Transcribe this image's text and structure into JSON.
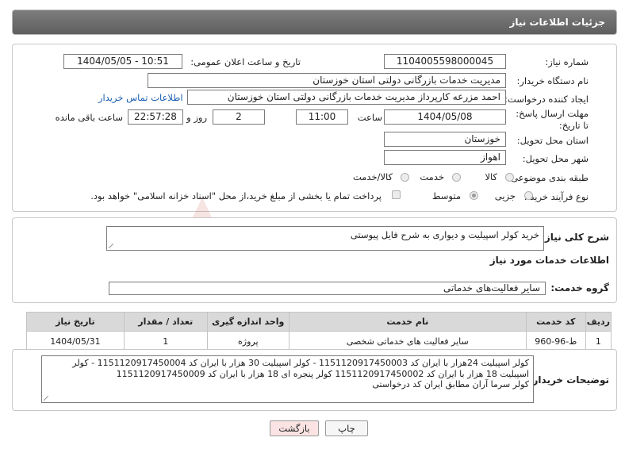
{
  "header": {
    "title": "جزئیات اطلاعات نیاز"
  },
  "form": {
    "need_number_label": "شماره نیاز:",
    "need_number": "1104005598000045",
    "announce_label": "تاریخ و ساعت اعلان عمومی:",
    "announce_value": "1404/05/05 - 10:51",
    "buyer_org_label": "نام دستگاه خریدار:",
    "buyer_org": "مدیریت خدمات بازرگانی دولتی استان خوزستان",
    "creator_label": "ایجاد کننده درخواست:",
    "creator": "احمد مزرعه کارپرداز مدیریت خدمات بازرگانی دولتی استان خوزستان",
    "contact_link": "اطلاعات تماس خریدار",
    "deadline_label": "مهلت ارسال پاسخ: تا تاریخ:",
    "deadline_date": "1404/05/08",
    "time_label": "ساعت",
    "deadline_time": "11:00",
    "days_value": "2",
    "days_label": "روز و",
    "remaining_time": "22:57:28",
    "remaining_label": "ساعت باقی مانده",
    "province_label": "استان محل تحویل:",
    "province": "خوزستان",
    "city_label": "شهر محل تحویل:",
    "city": "اهواز",
    "category_label": "طبقه بندی موضوعی:",
    "category_options": [
      "کالا",
      "خدمت",
      "کالا/خدمت"
    ],
    "process_label": "نوع فرآیند خرید :",
    "process_options": [
      "جزیی",
      "متوسط"
    ],
    "payment_note": "پرداخت تمام یا بخشی از مبلغ خرید،از محل \"اسناد خزانه اسلامی\" خواهد بود."
  },
  "summary": {
    "label": "شرح کلی نیاز:",
    "text": "خرید کولر اسپیلیت و دیواری به شرح فایل پیوستی"
  },
  "services": {
    "section_title": "اطلاعات خدمات مورد نیاز",
    "group_label": "گروه خدمت:",
    "group_value": "سایر فعالیت‌های خدماتی",
    "columns": [
      "ردیف",
      "کد خدمت",
      "نام خدمت",
      "واحد اندازه گیری",
      "تعداد / مقدار",
      "تاریخ نیاز"
    ],
    "rows": [
      [
        "1",
        "ط-96-960",
        "سایر فعالیت های خدماتی شخصی",
        "پروژه",
        "1",
        "1404/05/31"
      ]
    ]
  },
  "buyer_notes": {
    "label": "توضیحات خریدار:",
    "lines": [
      "کولر اسپیلیت 24هزار با ایران کد 1151120917450003 - کولر اسپیلیت 30 هزار با ایران کد 1151120917450004 - کولر",
      "اسپیلیت 18 هزار با ایران کد 1151120917450002 کولر پنجره ای 18 هزار با ایران کد 1151120917450009",
      "کولر سرما آران مطابق ایران کد درخواستی"
    ]
  },
  "buttons": {
    "print": "چاپ",
    "back": "بازگشت"
  },
  "watermark": {
    "text": "AriaTender.neT"
  },
  "colors": {
    "header": "#6b6b6b",
    "link": "#1a5fb4",
    "back_button": "#fbe3e3",
    "watermark": "#c0392b"
  }
}
